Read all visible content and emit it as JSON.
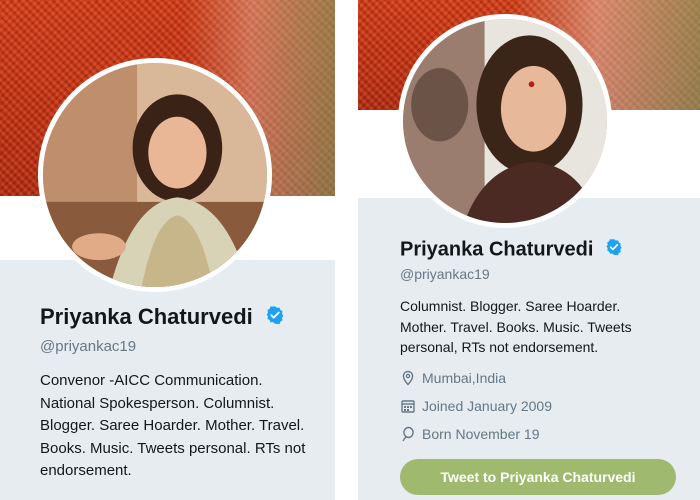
{
  "left_profile": {
    "name": "Priyanka Chaturvedi",
    "handle": "@priyankac19",
    "bio_lines": [
      "Convenor -AICC Communication.",
      "National Spokesperson. Columnist.",
      "Blogger. Saree Hoarder. Mother. Travel.",
      "Books. Music. Tweets personal. RTs not",
      "endorsement."
    ]
  },
  "right_profile": {
    "name": "Priyanka Chaturvedi",
    "handle": "@priyankac19",
    "bio_lines": [
      "Columnist. Blogger. Saree Hoarder.",
      "Mother. Travel. Books. Music. Tweets",
      "personal, RTs not endorsement."
    ],
    "location": "Mumbai,India",
    "joined": "Joined January 2009",
    "born": "Born November 19",
    "tweet_button_label": "Tweet to Priyanka Chaturvedi"
  },
  "icons": {
    "verified": "verified-badge-icon",
    "location": "location-pin-icon",
    "joined": "calendar-icon",
    "born": "balloon-icon"
  },
  "colors": {
    "verified_blue": "#1da1f2",
    "tweet_button": "#9fba6f",
    "banner_red": "#d83a12",
    "text_primary": "#14171a",
    "text_secondary": "#657786",
    "card_bg": "#e6ecf0"
  }
}
